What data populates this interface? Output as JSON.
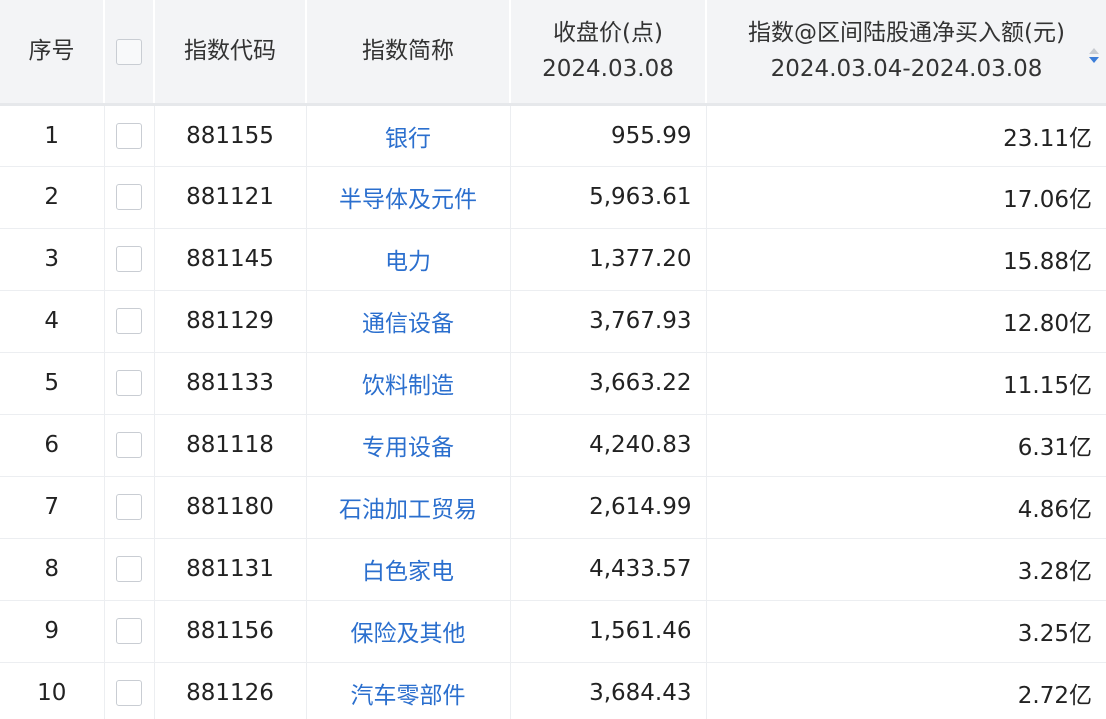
{
  "header": {
    "seq": "序号",
    "code": "指数代码",
    "name": "指数简称",
    "close_line1": "收盘价(点)",
    "close_line2": "2024.03.08",
    "flow_line1": "指数@区间陆股通净买入额(元)",
    "flow_line2": "2024.03.04-2024.03.08"
  },
  "rows": [
    {
      "seq": "1",
      "code": "881155",
      "name": "银行",
      "close": "955.99",
      "flow": "23.11亿"
    },
    {
      "seq": "2",
      "code": "881121",
      "name": "半导体及元件",
      "close": "5,963.61",
      "flow": "17.06亿"
    },
    {
      "seq": "3",
      "code": "881145",
      "name": "电力",
      "close": "1,377.20",
      "flow": "15.88亿"
    },
    {
      "seq": "4",
      "code": "881129",
      "name": "通信设备",
      "close": "3,767.93",
      "flow": "12.80亿"
    },
    {
      "seq": "5",
      "code": "881133",
      "name": "饮料制造",
      "close": "3,663.22",
      "flow": "11.15亿"
    },
    {
      "seq": "6",
      "code": "881118",
      "name": "专用设备",
      "close": "4,240.83",
      "flow": "6.31亿"
    },
    {
      "seq": "7",
      "code": "881180",
      "name": "石油加工贸易",
      "close": "2,614.99",
      "flow": "4.86亿"
    },
    {
      "seq": "8",
      "code": "881131",
      "name": "白色家电",
      "close": "4,433.57",
      "flow": "3.28亿"
    },
    {
      "seq": "9",
      "code": "881156",
      "name": "保险及其他",
      "close": "1,561.46",
      "flow": "3.25亿"
    },
    {
      "seq": "10",
      "code": "881126",
      "name": "汽车零部件",
      "close": "3,684.43",
      "flow": "2.72亿"
    }
  ],
  "colors": {
    "link": "#2b6fce",
    "header_bg": "#f3f4f6",
    "sort_active": "#3b7dd8"
  },
  "icons": {
    "checkbox": "checkbox-icon",
    "sort": "sort-icon"
  }
}
